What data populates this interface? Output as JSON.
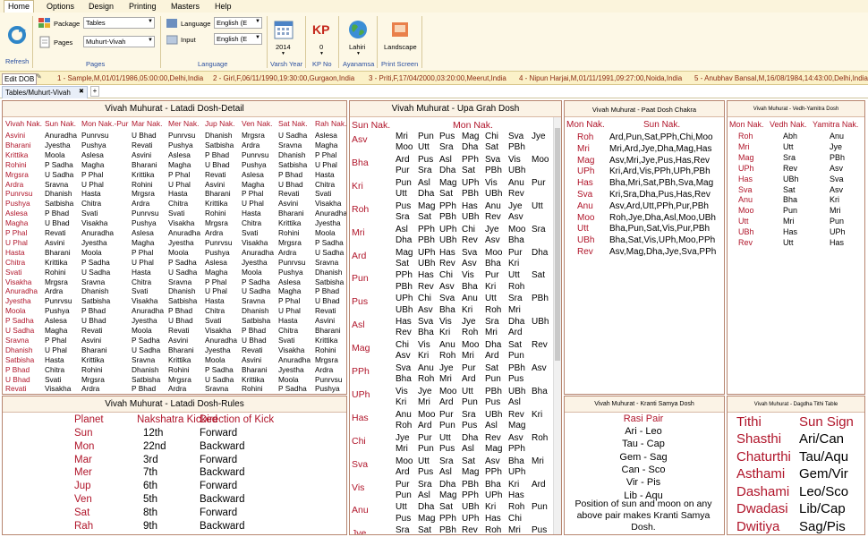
{
  "menu": {
    "items": [
      "Home",
      "Options",
      "Design",
      "Printing",
      "Masters",
      "Help"
    ]
  },
  "ribbon": {
    "refresh": "Refresh",
    "package_label": "Package",
    "package_value": "Tables",
    "pages_label": "Pages",
    "pages_value": "Muhurt-Vivah",
    "pages_caption": "Pages",
    "language_label": "Language",
    "language_value": "English (E",
    "input_label": "Input",
    "input_value": "English (E",
    "language_caption": "Language",
    "year_value": "2014",
    "year_caption": "Varsh Year",
    "kp_value": "0",
    "kp_caption": "KP No",
    "ayanamsa_value": "Lahiri",
    "ayanamsa_caption": "Ayanamsa",
    "print_value": "Landscape",
    "print_caption": "Print Screen"
  },
  "docbar": {
    "edit": "Edit DOB",
    "records": [
      "1 - Sample,M,01/01/1986,05:00:00,Delhi,India",
      "2 - Girl,F,06/11/1990,19:30:00,Gurgaon,India",
      "3 - Priti,F,17/04/2000,03:20:00,Meerut,India",
      "4 - Nipun Harjai,M,01/11/1991,09:27:00,Noida,India",
      "5 - Anubhav Bansal,M,16/08/1984,14:43:00,Delhi,India"
    ]
  },
  "tab": {
    "label": "Tables/Muhurt-Vivah",
    "close": "✖",
    "add": "+"
  },
  "latadi": {
    "title": "Vivah Muhurat - Latadi Dosh-Detail",
    "headers": [
      "Vivah Nak.",
      "Sun Nak.",
      "Mon Nak.-Pur",
      "Mar Nak.",
      "Mer Nak.",
      "Jup Nak.",
      "Ven Nak.",
      "Sat Nak.",
      "Rah Nak."
    ],
    "rows": [
      [
        "Asvini",
        "Anuradha",
        "Punrvsu",
        "U Bhad",
        "Punrvsu",
        "Dhanish",
        "Mrgsra",
        "U Sadha",
        "Aslesa"
      ],
      [
        "Bharani",
        "Jyestha",
        "Pushya",
        "Revati",
        "Pushya",
        "Satbisha",
        "Ardra",
        "Sravna",
        "Magha"
      ],
      [
        "Krittika",
        "Moola",
        "Aslesa",
        "Asvini",
        "Aslesa",
        "P Bhad",
        "Punrvsu",
        "Dhanish",
        "P Phal"
      ],
      [
        "Rohini",
        "P Sadha",
        "Magha",
        "Bharani",
        "Magha",
        "U Bhad",
        "Pushya",
        "Satbisha",
        "U Phal"
      ],
      [
        "Mrgsra",
        "U Sadha",
        "P Phal",
        "Krittika",
        "P Phal",
        "Revati",
        "Aslesa",
        "P Bhad",
        "Hasta"
      ],
      [
        "Ardra",
        "Sravna",
        "U Phal",
        "Rohini",
        "U Phal",
        "Asvini",
        "Magha",
        "U Bhad",
        "Chitra"
      ],
      [
        "Punrvsu",
        "Dhanish",
        "Hasta",
        "Mrgsra",
        "Hasta",
        "Bharani",
        "P Phal",
        "Revati",
        "Svati"
      ],
      [
        "Pushya",
        "Satbisha",
        "Chitra",
        "Ardra",
        "Chitra",
        "Krittika",
        "U Phal",
        "Asvini",
        "Visakha"
      ],
      [
        "Aslesa",
        "P Bhad",
        "Svati",
        "Punrvsu",
        "Svati",
        "Rohini",
        "Hasta",
        "Bharani",
        "Anuradha"
      ],
      [
        "Magha",
        "U Bhad",
        "Visakha",
        "Pushya",
        "Visakha",
        "Mrgsra",
        "Chitra",
        "Krittika",
        "Jyestha"
      ],
      [
        "P Phal",
        "Revati",
        "Anuradha",
        "Aslesa",
        "Anuradha",
        "Ardra",
        "Svati",
        "Rohini",
        "Moola"
      ],
      [
        "U Phal",
        "Asvini",
        "Jyestha",
        "Magha",
        "Jyestha",
        "Punrvsu",
        "Visakha",
        "Mrgsra",
        "P Sadha"
      ],
      [
        "Hasta",
        "Bharani",
        "Moola",
        "P Phal",
        "Moola",
        "Pushya",
        "Anuradha",
        "Ardra",
        "U Sadha"
      ],
      [
        "Chitra",
        "Krittika",
        "P Sadha",
        "U Phal",
        "P Sadha",
        "Aslesa",
        "Jyestha",
        "Punrvsu",
        "Sravna"
      ],
      [
        "Svati",
        "Rohini",
        "U Sadha",
        "Hasta",
        "U Sadha",
        "Magha",
        "Moola",
        "Pushya",
        "Dhanish"
      ],
      [
        "Visakha",
        "Mrgsra",
        "Sravna",
        "Chitra",
        "Sravna",
        "P Phal",
        "P Sadha",
        "Aslesa",
        "Satbisha"
      ],
      [
        "Anuradha",
        "Ardra",
        "Dhanish",
        "Svati",
        "Dhanish",
        "U Phal",
        "U Sadha",
        "Magha",
        "P Bhad"
      ],
      [
        "Jyestha",
        "Punrvsu",
        "Satbisha",
        "Visakha",
        "Satbisha",
        "Hasta",
        "Sravna",
        "P Phal",
        "U Bhad"
      ],
      [
        "Moola",
        "Pushya",
        "P Bhad",
        "Anuradha",
        "P Bhad",
        "Chitra",
        "Dhanish",
        "U Phal",
        "Revati"
      ],
      [
        "P Sadha",
        "Aslesa",
        "U Bhad",
        "Jyestha",
        "U Bhad",
        "Svati",
        "Satbisha",
        "Hasta",
        "Asvini"
      ],
      [
        "U Sadha",
        "Magha",
        "Revati",
        "Moola",
        "Revati",
        "Visakha",
        "P Bhad",
        "Chitra",
        "Bharani"
      ],
      [
        "Sravna",
        "P Phal",
        "Asvini",
        "P Sadha",
        "Asvini",
        "Anuradha",
        "U Bhad",
        "Svati",
        "Krittika"
      ],
      [
        "Dhanish",
        "U Phal",
        "Bharani",
        "U Sadha",
        "Bharani",
        "Jyestha",
        "Revati",
        "Visakha",
        "Rohini"
      ],
      [
        "Satbisha",
        "Hasta",
        "Krittika",
        "Sravna",
        "Krittika",
        "Moola",
        "Asvini",
        "Anuradha",
        "Mrgsra"
      ],
      [
        "P Bhad",
        "Chitra",
        "Rohini",
        "Dhanish",
        "Rohini",
        "P Sadha",
        "Bharani",
        "Jyestha",
        "Ardra"
      ],
      [
        "U Bhad",
        "Svati",
        "Mrgsra",
        "Satbisha",
        "Mrgsra",
        "U Sadha",
        "Krittika",
        "Moola",
        "Punrvsu"
      ],
      [
        "Revati",
        "Visakha",
        "Ardra",
        "P Bhad",
        "Ardra",
        "Sravna",
        "Rohini",
        "P Sadha",
        "Pushya"
      ]
    ]
  },
  "rules": {
    "title": "Vivah Muhurat - Latadi Dosh-Rules",
    "headers": [
      "Planet",
      "Nakshatra Kicked",
      "Direction of Kick"
    ],
    "rows": [
      [
        "Sun",
        "12th",
        "Forward"
      ],
      [
        "Mon",
        "22nd",
        "Backward"
      ],
      [
        "Mar",
        "3rd",
        "Forward"
      ],
      [
        "Mer",
        "7th",
        "Backward"
      ],
      [
        "Jup",
        "6th",
        "Forward"
      ],
      [
        "Ven",
        "5th",
        "Backward"
      ],
      [
        "Sat",
        "8th",
        "Forward"
      ],
      [
        "Rah",
        "9th",
        "Backward"
      ]
    ]
  },
  "upagrah": {
    "title": "Vivah Muhurat - Upa Grah Dosh",
    "h_sun": "Sun Nak.",
    "h_mon": "Mon Nak.",
    "groups": [
      {
        "name": "Asv",
        "lines": [
          [
            "Mri",
            "Pun",
            "Pus",
            "Mag",
            "Chi",
            "Sva",
            "Jye"
          ],
          [
            "Moo",
            "Utt",
            "Sra",
            "Dha",
            "Sat",
            "PBh"
          ]
        ]
      },
      {
        "name": "Bha",
        "lines": [
          [
            "Ard",
            "Pus",
            "Asl",
            "PPh",
            "Sva",
            "Vis",
            "Moo"
          ],
          [
            "Pur",
            "Sra",
            "Dha",
            "Sat",
            "PBh",
            "UBh"
          ]
        ]
      },
      {
        "name": "Kri",
        "lines": [
          [
            "Pun",
            "Asl",
            "Mag",
            "UPh",
            "Vis",
            "Anu",
            "Pur"
          ],
          [
            "Utt",
            "Dha",
            "Sat",
            "PBh",
            "UBh",
            "Rev"
          ]
        ]
      },
      {
        "name": "Roh",
        "lines": [
          [
            "Pus",
            "Mag",
            "PPh",
            "Has",
            "Anu",
            "Jye",
            "Utt"
          ],
          [
            "Sra",
            "Sat",
            "PBh",
            "UBh",
            "Rev",
            "Asv"
          ]
        ]
      },
      {
        "name": "Mri",
        "lines": [
          [
            "Asl",
            "PPh",
            "UPh",
            "Chi",
            "Jye",
            "Moo",
            "Sra"
          ],
          [
            "Dha",
            "PBh",
            "UBh",
            "Rev",
            "Asv",
            "Bha"
          ]
        ]
      },
      {
        "name": "Ard",
        "lines": [
          [
            "Mag",
            "UPh",
            "Has",
            "Sva",
            "Moo",
            "Pur",
            "Dha"
          ],
          [
            "Sat",
            "UBh",
            "Rev",
            "Asv",
            "Bha",
            "Kri"
          ]
        ]
      },
      {
        "name": "Pun",
        "lines": [
          [
            "PPh",
            "Has",
            "Chi",
            "Vis",
            "Pur",
            "Utt",
            "Sat"
          ],
          [
            "PBh",
            "Rev",
            "Asv",
            "Bha",
            "Kri",
            "Roh"
          ]
        ]
      },
      {
        "name": "Pus",
        "lines": [
          [
            "UPh",
            "Chi",
            "Sva",
            "Anu",
            "Utt",
            "Sra",
            "PBh"
          ],
          [
            "UBh",
            "Asv",
            "Bha",
            "Kri",
            "Roh",
            "Mri"
          ]
        ]
      },
      {
        "name": "Asl",
        "lines": [
          [
            "Has",
            "Sva",
            "Vis",
            "Jye",
            "Sra",
            "Dha",
            "UBh"
          ],
          [
            "Rev",
            "Bha",
            "Kri",
            "Roh",
            "Mri",
            "Ard"
          ]
        ]
      },
      {
        "name": "Mag",
        "lines": [
          [
            "Chi",
            "Vis",
            "Anu",
            "Moo",
            "Dha",
            "Sat",
            "Rev"
          ],
          [
            "Asv",
            "Kri",
            "Roh",
            "Mri",
            "Ard",
            "Pun"
          ]
        ]
      },
      {
        "name": "PPh",
        "lines": [
          [
            "Sva",
            "Anu",
            "Jye",
            "Pur",
            "Sat",
            "PBh",
            "Asv"
          ],
          [
            "Bha",
            "Roh",
            "Mri",
            "Ard",
            "Pun",
            "Pus"
          ]
        ]
      },
      {
        "name": "UPh",
        "lines": [
          [
            "Vis",
            "Jye",
            "Moo",
            "Utt",
            "PBh",
            "UBh",
            "Bha"
          ],
          [
            "Kri",
            "Mri",
            "Ard",
            "Pun",
            "Pus",
            "Asl"
          ]
        ]
      },
      {
        "name": "Has",
        "lines": [
          [
            "Anu",
            "Moo",
            "Pur",
            "Sra",
            "UBh",
            "Rev",
            "Kri"
          ],
          [
            "Roh",
            "Ard",
            "Pun",
            "Pus",
            "Asl",
            "Mag"
          ]
        ]
      },
      {
        "name": "Chi",
        "lines": [
          [
            "Jye",
            "Pur",
            "Utt",
            "Dha",
            "Rev",
            "Asv",
            "Roh"
          ],
          [
            "Mri",
            "Pun",
            "Pus",
            "Asl",
            "Mag",
            "PPh"
          ]
        ]
      },
      {
        "name": "Sva",
        "lines": [
          [
            "Moo",
            "Utt",
            "Sra",
            "Sat",
            "Asv",
            "Bha",
            "Mri"
          ],
          [
            "Ard",
            "Pus",
            "Asl",
            "Mag",
            "PPh",
            "UPh"
          ]
        ]
      },
      {
        "name": "Vis",
        "lines": [
          [
            "Pur",
            "Sra",
            "Dha",
            "PBh",
            "Bha",
            "Kri",
            "Ard"
          ],
          [
            "Pun",
            "Asl",
            "Mag",
            "PPh",
            "UPh",
            "Has"
          ]
        ]
      },
      {
        "name": "Anu",
        "lines": [
          [
            "Utt",
            "Dha",
            "Sat",
            "UBh",
            "Kri",
            "Roh",
            "Pun"
          ],
          [
            "Pus",
            "Mag",
            "PPh",
            "UPh",
            "Has",
            "Chi"
          ]
        ]
      },
      {
        "name": "Jye",
        "lines": [
          [
            "Sra",
            "Sat",
            "PBh",
            "Rev",
            "Roh",
            "Mri",
            "Pus"
          ],
          []
        ]
      }
    ]
  },
  "paat": {
    "title": "Vivah Muhurat - Paat Dosh Chakra",
    "h_mon": "Mon Nak.",
    "h_sun": "Sun Nak.",
    "rows": [
      [
        "Roh",
        "Ard,Pun,Sat,PPh,Chi,Moo"
      ],
      [
        "Mri",
        "Mri,Ard,Jye,Dha,Mag,Has"
      ],
      [
        "Mag",
        "Asv,Mri,Jye,Pus,Has,Rev"
      ],
      [
        "UPh",
        "Kri,Ard,Vis,PPh,UPh,PBh"
      ],
      [
        "Has",
        "Bha,Mri,Sat,PBh,Sva,Mag"
      ],
      [
        "Sva",
        "Kri,Sra,Dha,Pus,Has,Rev"
      ],
      [
        "Anu",
        "Asv,Ard,Utt,PPh,Pur,PBh"
      ],
      [
        "Moo",
        "Roh,Jye,Dha,Asl,Moo,UBh"
      ],
      [
        "Utt",
        "Bha,Pun,Sat,Vis,Pur,PBh"
      ],
      [
        "UBh",
        "Bha,Sat,Vis,UPh,Moo,PPh"
      ],
      [
        "Rev",
        "Asv,Mag,Dha,Jye,Sva,PPh"
      ]
    ]
  },
  "vedh": {
    "title": "Vivah Muhurat - Vedh-Yamitra Dosh",
    "headers": [
      "Mon Nak.",
      "Vedh Nak.",
      "Yamitra Nak."
    ],
    "rows": [
      [
        "Roh",
        "Abh",
        "Anu"
      ],
      [
        "Mri",
        "Utt",
        "Jye"
      ],
      [
        "Mag",
        "Sra",
        "PBh"
      ],
      [
        "UPh",
        "Rev",
        "Asv"
      ],
      [
        "Has",
        "UBh",
        "Sva"
      ],
      [
        "Sva",
        "Sat",
        "Asv"
      ],
      [
        "Anu",
        "Bha",
        "Kri"
      ],
      [
        "Moo",
        "Pun",
        "Mri"
      ],
      [
        "Utt",
        "Mri",
        "Pun"
      ],
      [
        "UBh",
        "Has",
        "UPh"
      ],
      [
        "Rev",
        "Utt",
        "Has"
      ]
    ]
  },
  "kranti": {
    "title": "Vivah Muhurat - Kranti Samya Dosh",
    "heading": "Rasi Pair",
    "pairs": [
      "Ari - Leo",
      "Tau - Cap",
      "Gem - Sag",
      "Can - Sco",
      "Vir - Pis",
      "Lib - Aqu"
    ],
    "note": "Position of sun and moon on any above pair makes Kranti Samya Dosh."
  },
  "dagdha": {
    "title": "Vivah Muhurat - Dagdha Tithi Table",
    "h_tithi": "Tithi",
    "h_sign": "Sun Sign",
    "rows": [
      [
        "Shasthi",
        "Ari/Can"
      ],
      [
        "Chaturthi",
        "Tau/Aqu"
      ],
      [
        "Asthami",
        "Gem/Vir"
      ],
      [
        "Dashami",
        "Leo/Sco"
      ],
      [
        "Dwadasi",
        "Lib/Cap"
      ],
      [
        "Dwitiya",
        "Sag/Pis"
      ]
    ]
  }
}
